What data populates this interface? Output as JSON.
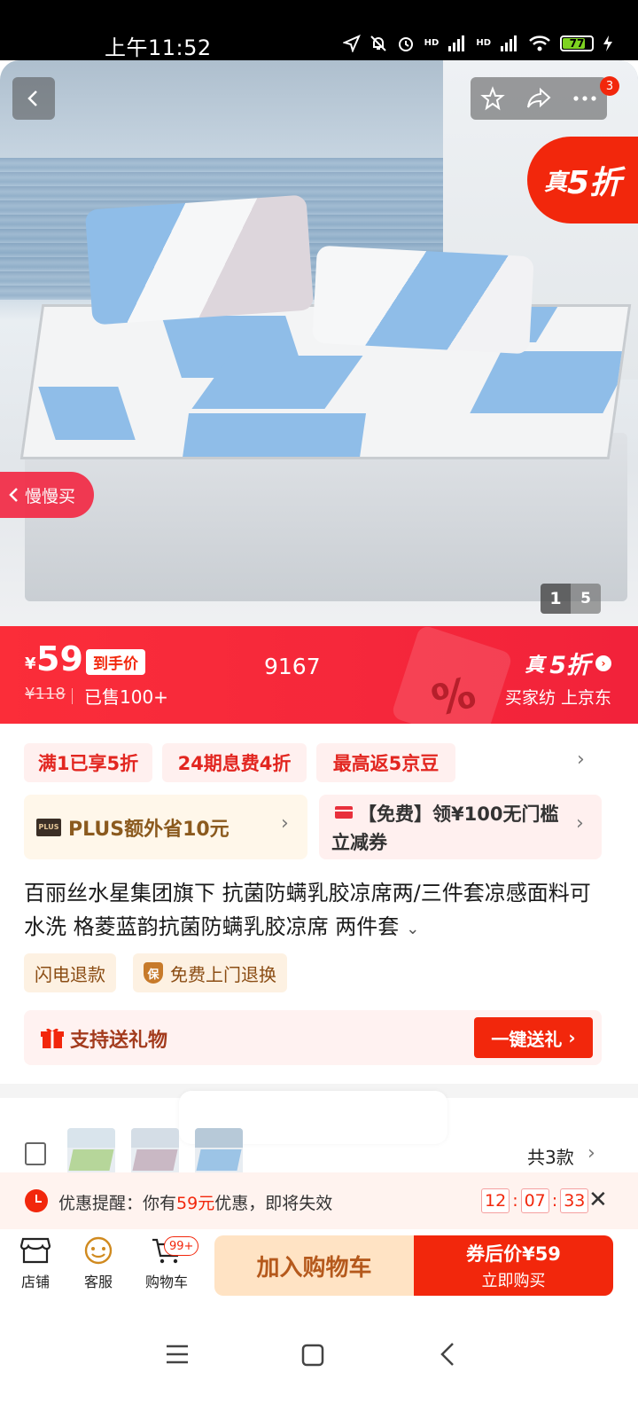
{
  "status_bar": {
    "time": "上午11:52",
    "battery": "77",
    "battery_level": 0.77,
    "network_label": "HD"
  },
  "hero": {
    "discount_tag_prefix": "真",
    "discount_tag_value": "5折",
    "slow_buy_label": "慢慢买",
    "action_badge": "3",
    "pager_current": "1",
    "pager_total": "5",
    "icons": [
      "back-icon",
      "star-icon",
      "share-icon",
      "more-icon"
    ]
  },
  "price_bar": {
    "currency": "¥",
    "price": "59",
    "final_price_tag": "到手价",
    "original_price": "¥118",
    "sold": "已售100+",
    "code": "9167",
    "discount_prefix": "真",
    "discount_value": "5折",
    "discount_sub": "买家纺 上京东",
    "percent_symbol": "%"
  },
  "promo_chips": [
    "满1已享5折",
    "24期息费4折",
    "最高返5京豆"
  ],
  "plus": {
    "logo_text": "PLUS",
    "text": "PLUS额外省10元"
  },
  "coupon": {
    "text": "【免费】领¥100无门槛立减券"
  },
  "product": {
    "title": "百丽丝水星集团旗下 抗菌防螨乳胶凉席两/三件套凉感面料可水洗 格菱蓝韵抗菌防螨乳胶凉席 两件套",
    "expand_icon": "⌄"
  },
  "services": [
    {
      "label": "闪电退款"
    },
    {
      "label": "免费上门退换",
      "badge": "保"
    }
  ],
  "gift": {
    "label": "支持送礼物",
    "button": "一键送礼"
  },
  "variants": {
    "count_label": "共3款"
  },
  "reminder": {
    "prefix": "优惠提醒：你有",
    "amount": "59元",
    "suffix": "优惠，即将失效",
    "timer": [
      "12",
      "07",
      "33"
    ]
  },
  "bottom_bar": {
    "shop": "店铺",
    "service": "客服",
    "cart": "购物车",
    "cart_badge": "99+",
    "add_to_cart": "加入购物车",
    "buy_line1": "券后价¥59",
    "buy_line2": "立即购买"
  },
  "colors": {
    "accent": "#f2270c",
    "price_bar": "#f5273b",
    "plus_text": "#8b5a1e",
    "cart_button": "#ffe3c4"
  }
}
